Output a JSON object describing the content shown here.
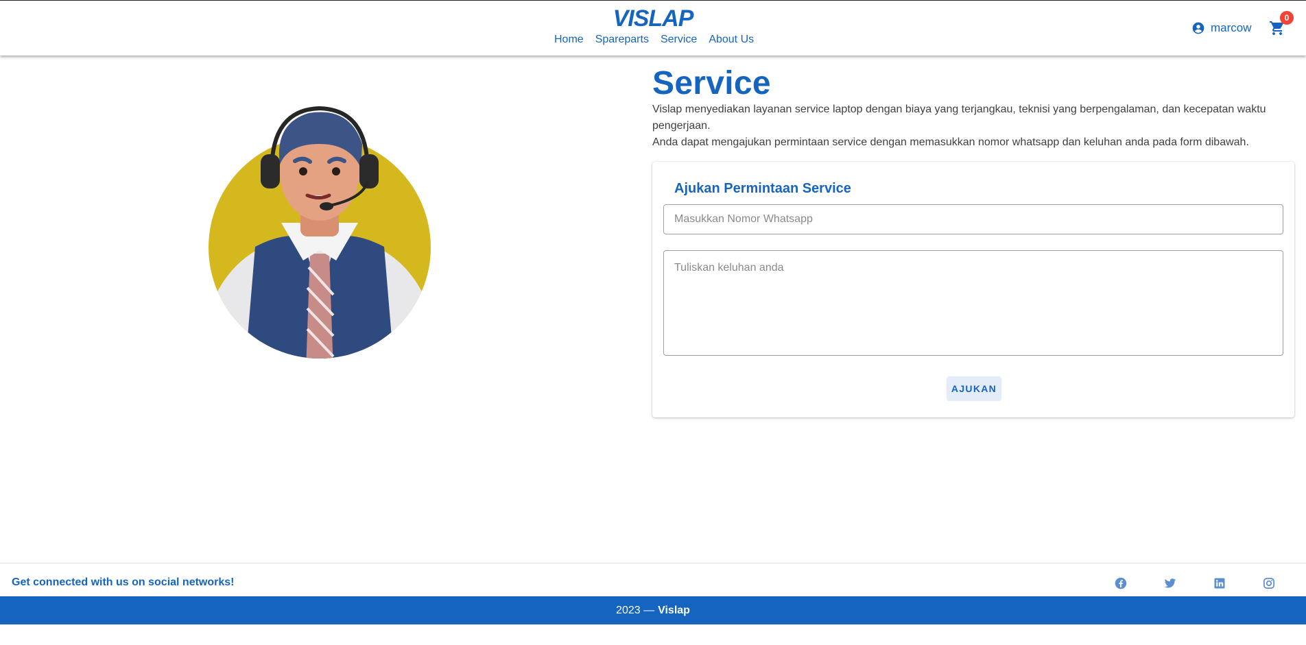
{
  "brand": {
    "logo_text": "VISLAP"
  },
  "nav": {
    "items": [
      "Home",
      "Spareparts",
      "Service",
      "About Us"
    ]
  },
  "user": {
    "username": "marcow",
    "cart_count": "0"
  },
  "colors": {
    "primary": "#1565c0",
    "badge": "#f44336",
    "avatar_bg": "#d4b81e"
  },
  "service": {
    "title": "Service",
    "description_1": "Vislap menyediakan layanan service laptop dengan biaya yang terjangkau, teknisi yang berpengalaman, dan kecepatan waktu pengerjaan.",
    "description_2": "Anda dapat mengajukan permintaan service dengan memasukkan nomor whatsapp dan keluhan anda pada form dibawah."
  },
  "form": {
    "title": "Ajukan Permintaan Service",
    "whatsapp_placeholder": "Masukkan Nomor Whatsapp",
    "whatsapp_value": "",
    "complaint_placeholder": "Tuliskan keluhan anda",
    "complaint_value": "",
    "submit_label": "AJUKAN"
  },
  "footer": {
    "social_text": "Get connected with us on social networks!",
    "social_icons": [
      "facebook-icon",
      "twitter-icon",
      "linkedin-icon",
      "instagram-icon"
    ],
    "copyright_year": "2023 —",
    "copyright_brand": "Vislap"
  }
}
